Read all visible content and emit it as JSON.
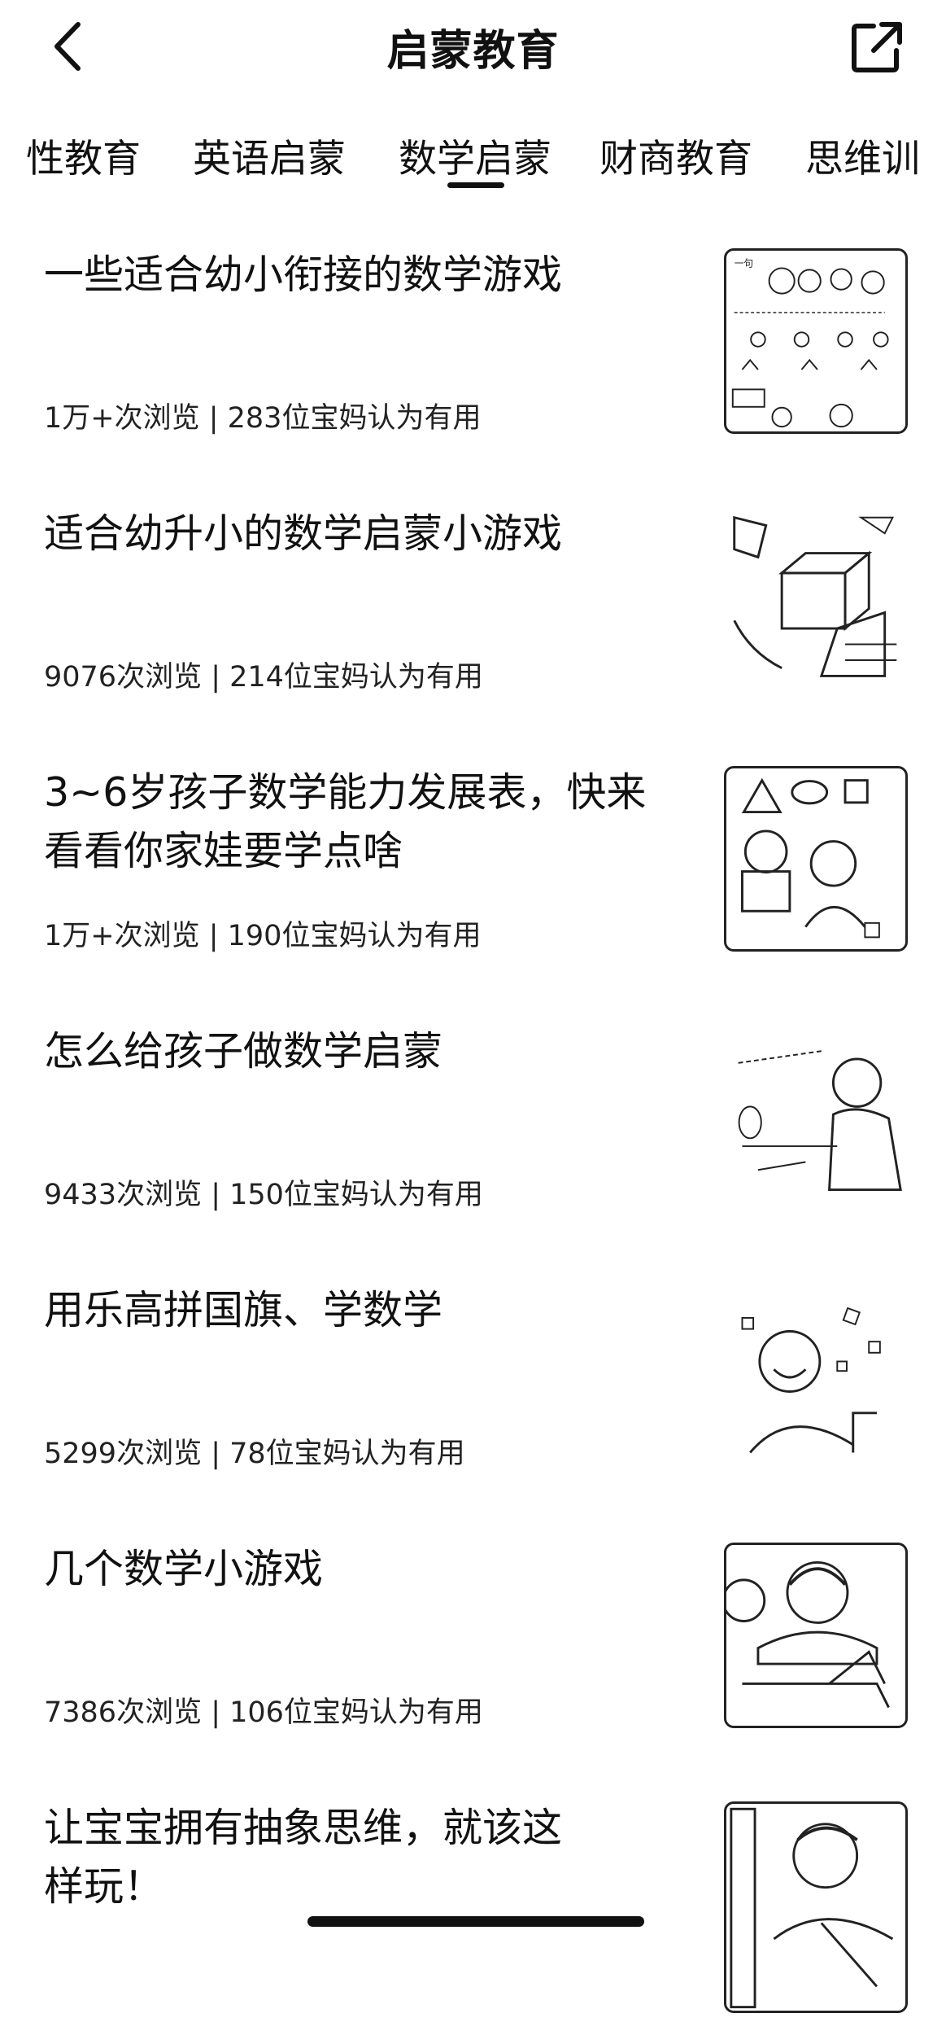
{
  "header": {
    "title": "启蒙教育"
  },
  "tabs": [
    {
      "label": "性教育"
    },
    {
      "label": "英语启蒙"
    },
    {
      "label": "数学启蒙",
      "active": true
    },
    {
      "label": "财商教育"
    },
    {
      "label": "思维训"
    }
  ],
  "articles": [
    {
      "title": "一些适合幼小衔接的数学游戏",
      "meta": "1万+次浏览 | 283位宝妈认为有用"
    },
    {
      "title": "适合幼升小的数学启蒙小游戏",
      "meta": "9076次浏览 | 214位宝妈认为有用"
    },
    {
      "title": "3~6岁孩子数学能力发展表，快来看看你家娃要学点啥",
      "meta": "1万+次浏览 | 190位宝妈认为有用"
    },
    {
      "title": "怎么给孩子做数学启蒙",
      "meta": "9433次浏览 | 150位宝妈认为有用"
    },
    {
      "title": "用乐高拼国旗、学数学",
      "meta": "5299次浏览 | 78位宝妈认为有用"
    },
    {
      "title": "几个数学小游戏",
      "meta": "7386次浏览 | 106位宝妈认为有用"
    },
    {
      "title": "让宝宝拥有抽象思维，就该这样玩！",
      "meta": ""
    }
  ]
}
